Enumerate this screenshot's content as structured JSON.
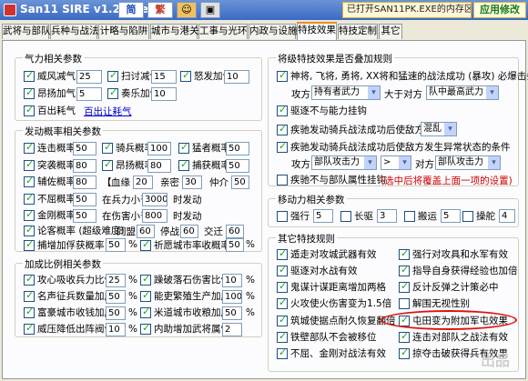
{
  "window": {
    "title": "San11 SIRE v1.26pre",
    "status": "已打开SAN11PK.EXE的内存区",
    "apply": "应用修改",
    "toolbar": {
      "b1": "",
      "b2": "i",
      "simplified": "简",
      "traditional": "繁"
    }
  },
  "tabs": [
    "武将与部队",
    "兵种与战法",
    "计略与陷阱",
    "城市与港关",
    "工事与光环",
    "内政与设施",
    "特技效果",
    "特技定制",
    "其它"
  ],
  "qili": {
    "title": "气力相关参数",
    "rows": [
      [
        {
          "label": "威风减气",
          "value": "25",
          "on": true
        },
        {
          "label": "扫讨减气",
          "value": "15",
          "on": true
        },
        {
          "label": "怒发加气",
          "value": "10",
          "on": true
        }
      ],
      [
        {
          "label": "昂扬加气",
          "value": "5",
          "on": true
        },
        {
          "label": "奏乐加气",
          "value": "10",
          "on": true
        }
      ],
      [
        {
          "label": "百出耗气",
          "on": true
        }
      ]
    ],
    "link": "百出让耗气"
  },
  "fadong": {
    "title": "发动概率相关参数",
    "lianzhan": {
      "label": "连击概率",
      "value": "50"
    },
    "qiangma": {
      "label": "骑兵概率",
      "value": "100"
    },
    "mengqi": {
      "label": "猛者概率",
      "value": "50"
    },
    "tujixi": {
      "label": "突袭概率",
      "value": "80"
    },
    "quanjin": {
      "label": "昂扬概率",
      "value": "80"
    },
    "shoujun": {
      "label": "捕获概率",
      "value": "50"
    },
    "fuzuo": {
      "label": "辅佐概率",
      "value": "80"
    },
    "xuemai": {
      "label": "血缘",
      "value": "20"
    },
    "qinmi": {
      "label": "亲密",
      "value": "30"
    },
    "zhongjie": {
      "label": "仲介",
      "value": "50"
    },
    "buqu": {
      "label": "不屈概率",
      "value": "50",
      "cond": "在兵力小于",
      "hp": "3000",
      "tail": "时发动"
    },
    "jingang": {
      "label": "金刚概率",
      "value": "50",
      "cond": "在伤害小于",
      "hp": "800",
      "tail": "时发动"
    },
    "lunmi": {
      "label": "论客概率 (超级难度)",
      "a": "同盟",
      "av": "60",
      "b": "停战",
      "bv": "60",
      "c": "交迁",
      "cv": "60"
    },
    "buzhuo": {
      "label": "捕增加俘获概率",
      "value": "50",
      "unit": "%"
    },
    "qidao": {
      "label": "祈愿城市率收概率",
      "value": "50",
      "unit": "%"
    }
  },
  "jiacheng": {
    "title": "加成比例相关参数",
    "rows": [
      [
        {
          "label": "攻心吸收兵力比例",
          "value": "25",
          "unit": "%"
        },
        {
          "label": "躁破落石伤害比例",
          "value": "10",
          "unit": "%"
        }
      ],
      [
        {
          "label": "名声征兵数量加成",
          "value": "50",
          "unit": "%"
        },
        {
          "label": "能吏繁殖生产加成",
          "value": "100",
          "unit": "%"
        }
      ],
      [
        {
          "label": "富豪城市收钱加成",
          "value": "50",
          "unit": "%"
        },
        {
          "label": "米道城市收粮加成",
          "value": "50",
          "unit": "%"
        }
      ],
      [
        {
          "label": "威压降低出阵阀值",
          "value": "10",
          "unit": "%"
        },
        {
          "label": "内助增加武将属性",
          "value": "2",
          "unit": ""
        }
      ]
    ]
  },
  "pidu": {
    "title": "将级特技效果是否叠加规则",
    "r1": "神将, 飞将, 勇将, XX将和猛速的战法成功 (暴攻) 必爆击条件",
    "r1a": "攻方",
    "r1a_sel": "持有者武力",
    "r1b": "大于对方",
    "r1b_sel": "队中最高武力",
    "r2": "驱逐不与能力挂钩",
    "r3": "疾驰发动骑兵战法成功后使敌方",
    "r3_sel": "混乱",
    "r4": "疾驰发动骑兵战法成功后使敌方发生异常状态的条件",
    "r4a": "攻方",
    "r4a_sel": "部队攻击力",
    "r4b_sel": ">",
    "r4c": "对方",
    "r4c_sel": "部队攻击力",
    "r5": "疾驰不与部队属性挂钩",
    "r5_note": "(选中后将覆盖上面一项的设置)"
  },
  "yidong": {
    "title": "移动力相关参数",
    "items": [
      {
        "label": "强行",
        "value": "5"
      },
      {
        "label": "长驱",
        "value": "3"
      },
      {
        "label": "搬运",
        "value": "5"
      },
      {
        "label": "操舵",
        "value": "4"
      }
    ]
  },
  "qita": {
    "title": "其它特技规则",
    "items": [
      {
        "label": "遁走对攻城武器有效",
        "on": true
      },
      {
        "label": "强行对攻具和水军有效",
        "on": true
      },
      {
        "label": "驱逐对水战有效",
        "on": true
      },
      {
        "label": "指导自身获得经验也加倍",
        "on": true
      },
      {
        "label": "鬼谋计谋距离增加两格",
        "on": true
      },
      {
        "label": "反计反弹之计策必中",
        "on": true
      },
      {
        "label": "火攻使火伤害变为1.5倍",
        "on": true
      },
      {
        "label": "解围无视性别",
        "on": false
      },
      {
        "label": "筑城使据点耐久恢复翻倍",
        "on": true
      },
      {
        "label": "屯田变为附加军屯效果",
        "on": true
      },
      {
        "label": "铁壁部队不会被移位",
        "on": true
      },
      {
        "label": "连击对部队之战法有效",
        "on": true
      },
      {
        "label": "不屈、金刚对战法有效",
        "on": true
      },
      {
        "label": "掠夺击破获得兵有效果",
        "on": true
      }
    ]
  },
  "watermark": "出品"
}
